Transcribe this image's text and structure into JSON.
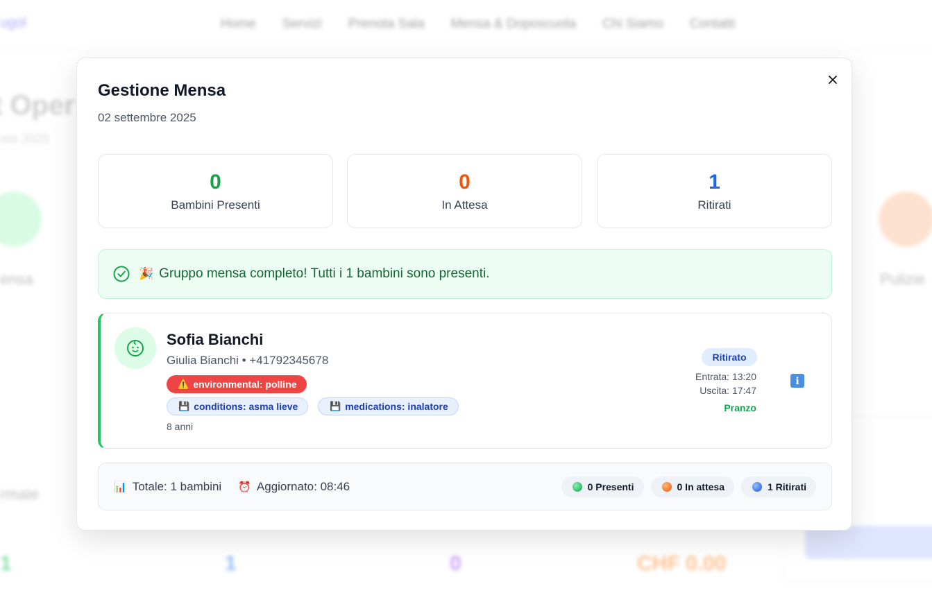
{
  "modal": {
    "title": "Gestione Mensa",
    "date": "02 settembre 2025"
  },
  "stats": [
    {
      "value": "0",
      "label": "Bambini Presenti",
      "color": "#16a34a"
    },
    {
      "value": "0",
      "label": "In Attesa",
      "color": "#ea580c"
    },
    {
      "value": "1",
      "label": "Ritirati",
      "color": "#2563eb"
    }
  ],
  "alert": {
    "emoji": "🎉",
    "text": "Gruppo mensa completo! Tutti i 1 bambini sono presenti."
  },
  "child": {
    "name": "Sofia Bianchi",
    "parent": "Giulia Bianchi • +41792345678",
    "tags": [
      {
        "icon": "⚠️",
        "text": "environmental: polline"
      },
      {
        "icon": "💾",
        "text": "conditions: asma lieve"
      },
      {
        "icon": "💾",
        "text": "medications: inalatore"
      }
    ],
    "age": "8 anni",
    "status": "Ritirato",
    "entry": "Entrata: 13:20",
    "exit": "Uscita: 17:47",
    "meal": "Pranzo",
    "info_icon": "ℹ"
  },
  "footer": {
    "total_emoji": "📊",
    "total": "Totale: 1 bambini",
    "updated_emoji": "⏰",
    "updated": "Aggiornato: 08:46",
    "chips": [
      {
        "text": "0 Presenti"
      },
      {
        "text": "0 In attesa"
      },
      {
        "text": "1 Ritirati"
      }
    ]
  },
  "background": {
    "logo": "ugol",
    "nav": [
      "Home",
      "Servizi",
      "Prenota Sala",
      "Mensa & Doposcuola",
      "Chi Siamo",
      "Contatti"
    ],
    "title": "t Oper",
    "subtitle": "ore 2025",
    "label_left": "ensa",
    "label_right": "Pulizie",
    "label_bottom": "rmate",
    "stats": [
      "1",
      "1",
      "0",
      "CHF 0.00"
    ]
  }
}
